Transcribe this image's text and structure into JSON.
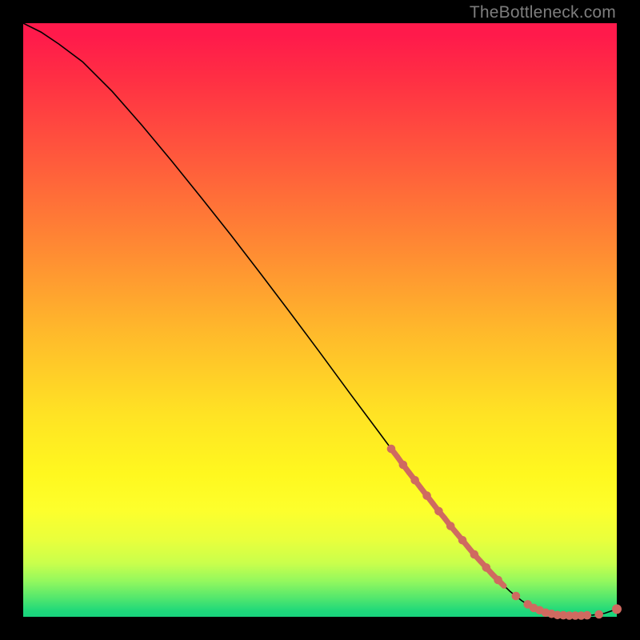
{
  "watermark": "TheBottleneck.com",
  "colors": {
    "line": "#000000",
    "dot": "#cf6a60",
    "bg_black": "#000000"
  },
  "chart_data": {
    "type": "line",
    "title": "",
    "xlabel": "",
    "ylabel": "",
    "xlim": [
      0,
      100
    ],
    "ylim": [
      0,
      100
    ],
    "grid": false,
    "legend": false,
    "series": [
      {
        "name": "bottleneck-curve",
        "x": [
          0,
          3,
          6,
          10,
          15,
          20,
          25,
          30,
          35,
          40,
          45,
          50,
          55,
          60,
          62,
          64,
          66,
          68,
          70,
          72,
          74,
          76,
          78,
          80,
          82,
          84,
          86,
          88,
          90,
          92,
          94,
          96,
          98,
          100
        ],
        "y": [
          100,
          98.5,
          96.5,
          93.5,
          88.5,
          82.8,
          76.8,
          70.6,
          64.3,
          57.8,
          51.2,
          44.5,
          37.7,
          31.0,
          28.3,
          25.6,
          23.0,
          20.4,
          17.8,
          15.3,
          12.9,
          10.5,
          8.3,
          6.2,
          4.3,
          2.7,
          1.5,
          0.7,
          0.3,
          0.2,
          0.2,
          0.3,
          0.6,
          1.3
        ]
      }
    ],
    "highlighted_points": {
      "name": "tail-markers",
      "x": [
        62,
        63,
        64,
        65,
        66,
        67,
        68,
        69,
        70,
        71,
        72,
        73,
        74,
        75,
        76,
        77,
        78,
        79,
        80,
        81,
        83,
        85,
        86,
        87,
        88,
        89,
        90,
        91,
        92,
        93,
        94,
        95,
        97,
        100
      ],
      "y": [
        28.3,
        27.0,
        25.6,
        24.3,
        23.0,
        21.7,
        20.4,
        19.1,
        17.8,
        16.6,
        15.3,
        14.1,
        12.9,
        11.7,
        10.5,
        9.4,
        8.3,
        7.2,
        6.2,
        5.2,
        3.5,
        2.1,
        1.5,
        1.1,
        0.7,
        0.5,
        0.3,
        0.25,
        0.2,
        0.2,
        0.2,
        0.25,
        0.4,
        1.3
      ]
    }
  }
}
